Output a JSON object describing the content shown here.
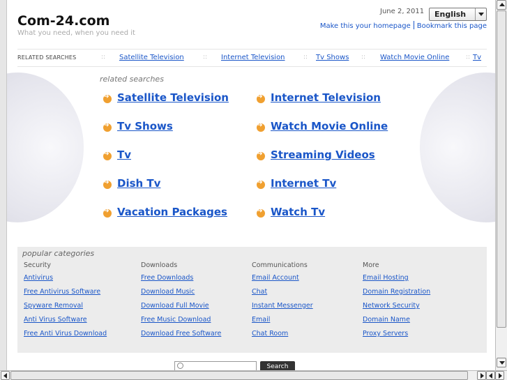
{
  "header": {
    "title": "Com-24.com",
    "tagline": "What you need, when you need it",
    "date": "June 2, 2011",
    "language": "English",
    "make_homepage": "Make this your homepage",
    "bookmark": "Bookmark this page"
  },
  "related_bar": {
    "label": "RELATED SEARCHES",
    "separator": "::",
    "links": [
      "Satellite Television",
      "Internet Television",
      "Tv Shows",
      "Watch Movie Online",
      "Tv"
    ]
  },
  "related": {
    "heading": "related searches",
    "left": [
      "Satellite Television",
      "Tv Shows",
      "Tv",
      "Dish Tv",
      "Vacation Packages"
    ],
    "right": [
      "Internet Television",
      "Watch Movie Online",
      "Streaming Videos",
      "Internet Tv",
      "Watch Tv"
    ]
  },
  "categories": {
    "heading": "popular categories",
    "columns": [
      {
        "title": "Security",
        "links": [
          "Antivirus",
          "Free Antivirus Software",
          "Spyware Removal",
          "Anti Virus Software",
          "Free Anti Virus Download"
        ]
      },
      {
        "title": "Downloads",
        "links": [
          "Free Downloads",
          "Download Music",
          "Download Full Movie",
          "Free Music Download",
          "Download Free Software"
        ]
      },
      {
        "title": "Communications",
        "links": [
          "Email Account",
          "Chat",
          "Instant Messenger",
          "Email",
          "Chat Room"
        ]
      },
      {
        "title": "More",
        "links": [
          "Email Hosting",
          "Domain Registration",
          "Network Security",
          "Domain Name",
          "Proxy Servers"
        ]
      }
    ]
  },
  "search": {
    "button": "Search",
    "value": ""
  },
  "colors": {
    "link": "#1a56c8",
    "arrow": "#f0a030",
    "category_bg": "#ececec"
  }
}
